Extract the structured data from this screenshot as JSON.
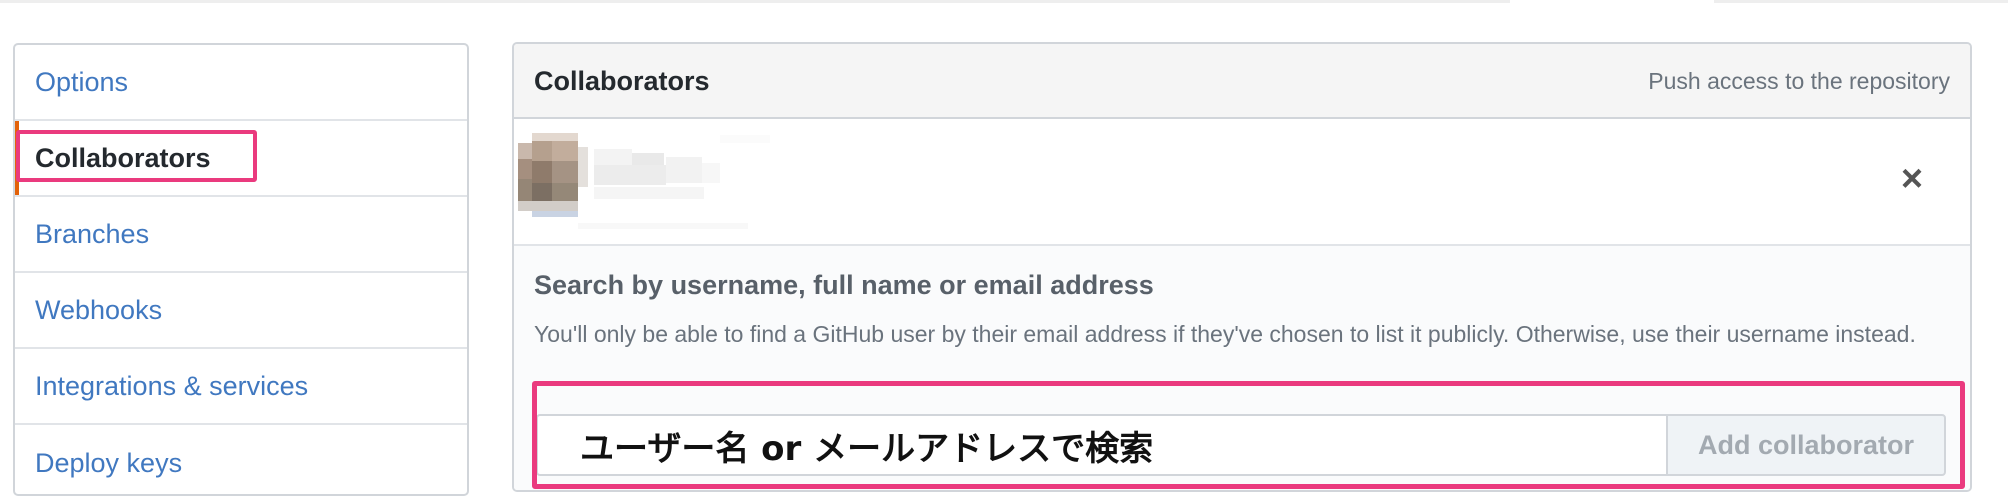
{
  "sidebar": {
    "items": [
      {
        "label": "Options"
      },
      {
        "label": "Collaborators",
        "selected": true
      },
      {
        "label": "Branches"
      },
      {
        "label": "Webhooks"
      },
      {
        "label": "Integrations & services"
      },
      {
        "label": "Deploy keys"
      }
    ]
  },
  "collaborators_panel": {
    "title": "Collaborators",
    "note": "Push access to the repository",
    "remove_icon_char": "×",
    "search_heading": "Search by username, full name or email address",
    "search_help": "You'll only be able to find a GitHub user by their email address if they've chosen to list it publicly. Otherwise, use their username instead.",
    "search_input_value": "ユーザー名 or メールアドレスで検索",
    "add_button_label": "Add collaborator"
  },
  "colors": {
    "link": "#4078c0",
    "selected_accent": "#e36209",
    "annotation": "#ea3a7e"
  }
}
